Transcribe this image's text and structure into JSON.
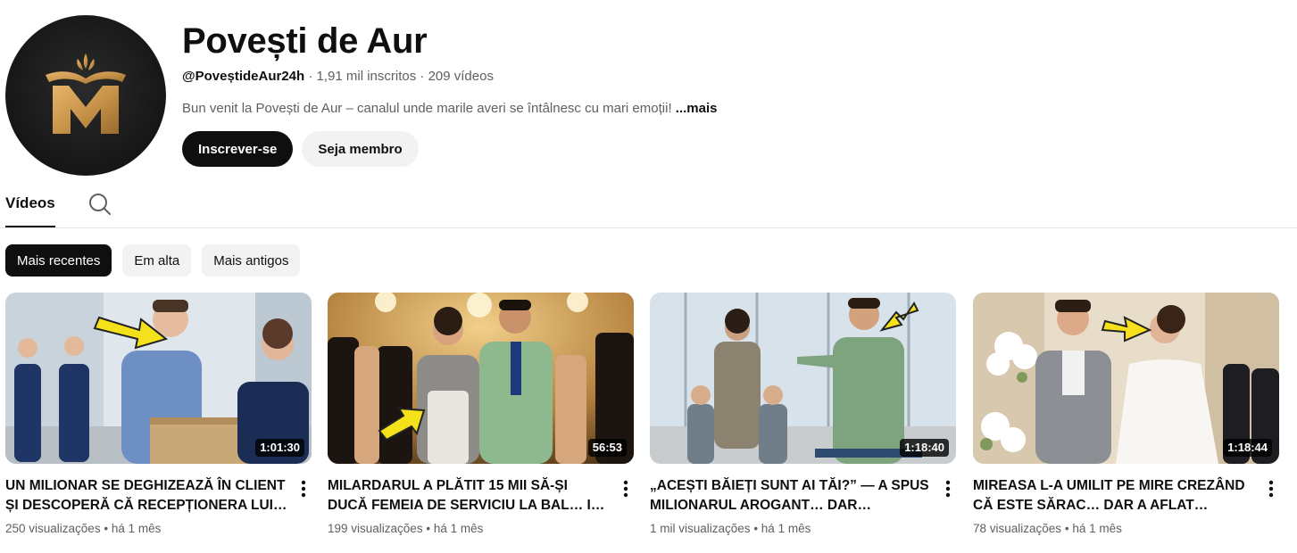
{
  "channel": {
    "name": "Povești de Aur",
    "handle": "@PoveștideAur24h",
    "subscribers": "1,91 mil inscritos",
    "video_count": "209 vídeos",
    "separator": "·",
    "description": "Bun venit la Povești de Aur – canalul unde marile averi se întâlnesc cu mari emoții!",
    "more_label": "...mais",
    "avatar_icon": "golden-book-m-logo",
    "subscribe_label": "Inscrever-se",
    "join_label": "Seja membro"
  },
  "tabs": {
    "videos_label": "Vídeos",
    "search_icon": "search-icon"
  },
  "filters": {
    "chips": [
      "Mais recentes",
      "Em alta",
      "Mais antigos"
    ],
    "active": "Mais recentes"
  },
  "videos": [
    {
      "title": "UN MILIONAR SE DEGHIZEAZĂ ÎN CLIENT ȘI DESCOPERĂ CĂ RECEPȚIONERA LUI AR…",
      "duration": "1:01:30",
      "views": "250 visualizações",
      "age": "há 1 mês"
    },
    {
      "title": "MILARDARUL A PLĂTIT 15 MII SĂ-ȘI DUCĂ FEMEIA DE SERVICIU LA BAL… IAR GESTU…",
      "duration": "56:53",
      "views": "199 visualizações",
      "age": "há 1 mês"
    },
    {
      "title": "„ACEȘTI BĂIEȚI SUNT AI TĂI?” — A SPUS MILIONARUL AROGANT… DAR RĂSPUNSU…",
      "duration": "1:18:40",
      "views": "1 mil visualizações",
      "age": "há 1 mês"
    },
    {
      "title": "MIREASA L-A UMILIT PE MIRE CREZÂND CĂ ESTE SĂRAC… DAR A AFLAT ADEVĂRUL ÎN…",
      "duration": "1:18:44",
      "views": "78 visualizações",
      "age": "há 1 mês"
    }
  ],
  "colors": {
    "accent_gold": "#c8954a",
    "dark": "#0f0f0f",
    "secondary_text": "#606060",
    "chip_bg": "#f2f2f2",
    "arrow_yellow": "#f5e11a"
  }
}
